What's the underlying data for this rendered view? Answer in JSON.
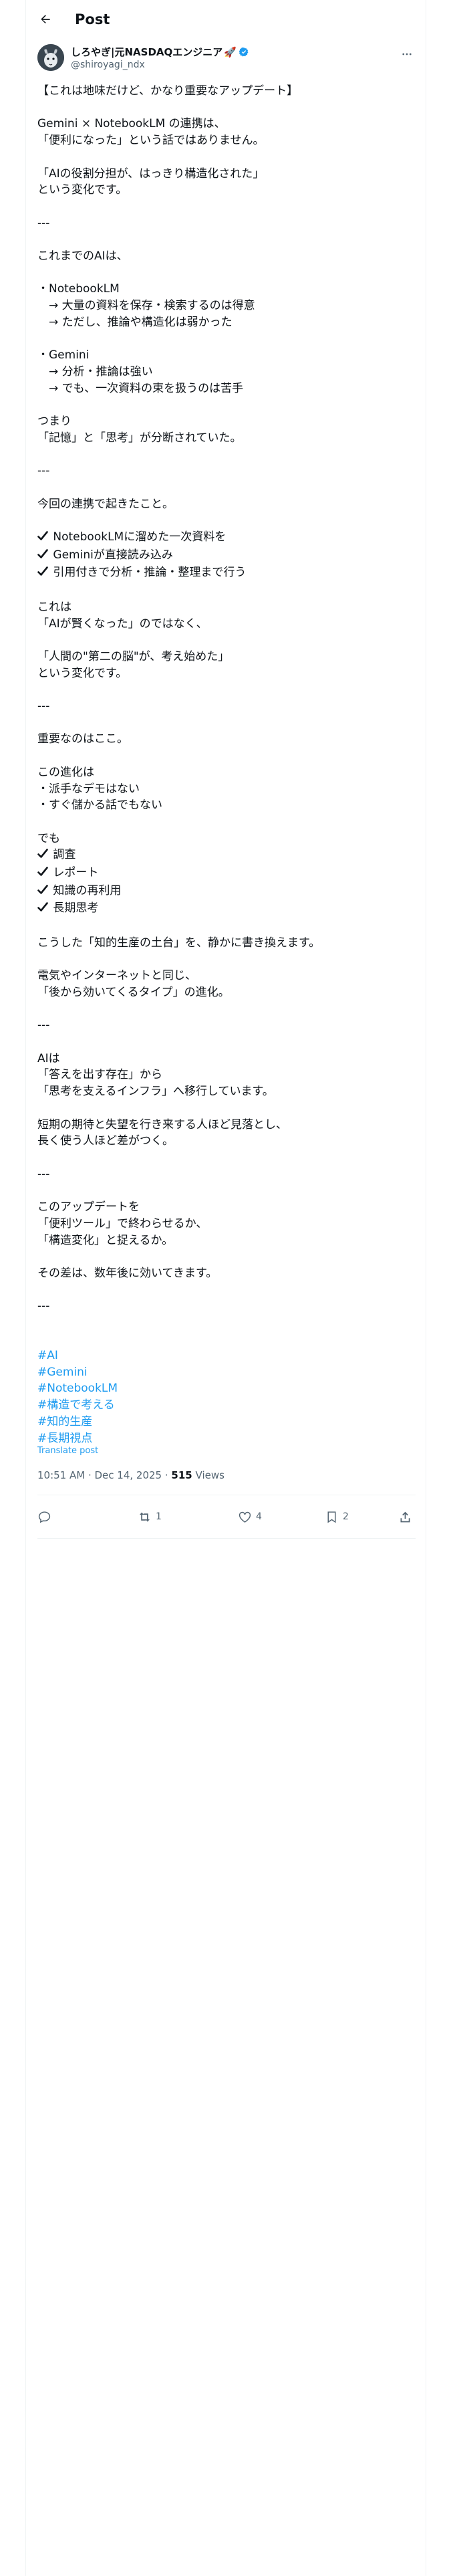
{
  "header": {
    "title": "Post"
  },
  "author": {
    "name": "しろやぎ|元NASDAQエンジニア",
    "name_emoji": "🚀",
    "handle": "@shiroyagi_ndx"
  },
  "post": {
    "paragraphs": [
      "【これは地味だけど、かなり重要なアップデート】",
      "",
      "Gemini × NotebookLM の連携は、",
      "「便利になった」という話ではありません。",
      "",
      "「AIの役割分担が、はっきり構造化された」",
      "という変化です。",
      "",
      "---",
      "",
      "これまでのAIは、",
      "",
      "・NotebookLM",
      "　→ 大量の資料を保存・検索するのは得意",
      "　→ ただし、推論や構造化は弱かった",
      "",
      "・Gemini",
      "　→ 分析・推論は強い",
      "　→ でも、一次資料の束を扱うのは苦手",
      "",
      "つまり",
      "「記憶」と「思考」が分断されていた。",
      "",
      "---",
      "",
      "今回の連携で起きたこと。",
      ""
    ],
    "checks_1": [
      "NotebookLMに溜めた一次資料を",
      "Geminiが直接読み込み",
      "引用付きで分析・推論・整理まで行う"
    ],
    "paragraphs_2": [
      "",
      "これは",
      "「AIが賢くなった」のではなく、",
      "",
      "「人間の\"第二の脳\"が、考え始めた」",
      "という変化です。",
      "",
      "---",
      "",
      "重要なのはここ。",
      "",
      "この進化は",
      "・派手なデモはない",
      "・すぐ儲かる話でもない",
      "",
      "でも"
    ],
    "checks_2": [
      "調査",
      "レポート",
      "知識の再利用",
      "長期思考"
    ],
    "paragraphs_3": [
      "",
      "こうした「知的生産の土台」を、静かに書き換えます。",
      "",
      "電気やインターネットと同じ、",
      "「後から効いてくるタイプ」の進化。",
      "",
      "---",
      "",
      "AIは",
      "「答えを出す存在」から",
      "「思考を支えるインフラ」へ移行しています。",
      "",
      "短期の期待と失望を行き来する人ほど見落とし、",
      "長く使う人ほど差がつく。",
      "",
      "---",
      "",
      "このアップデートを",
      "「便利ツール」で終わらせるか、",
      "「構造変化」と捉えるか。",
      "",
      "その差は、数年後に効いてきます。",
      "",
      "---"
    ],
    "hashtags": [
      "#AI",
      "#Gemini",
      "#NotebookLM",
      "#構造で考える",
      "#知的生産",
      "#長期視点"
    ],
    "translate_label": "Translate post",
    "timestamp": "10:51 AM · Dec 14, 2025",
    "views_count": "515",
    "views_label": "Views"
  },
  "actions": {
    "reply_count": "",
    "repost_count": "1",
    "like_count": "4",
    "bookmark_count": "2"
  },
  "colors": {
    "accent": "#1d9bf0",
    "text": "#0f1419",
    "muted": "#536471",
    "border": "#eff3f4"
  }
}
